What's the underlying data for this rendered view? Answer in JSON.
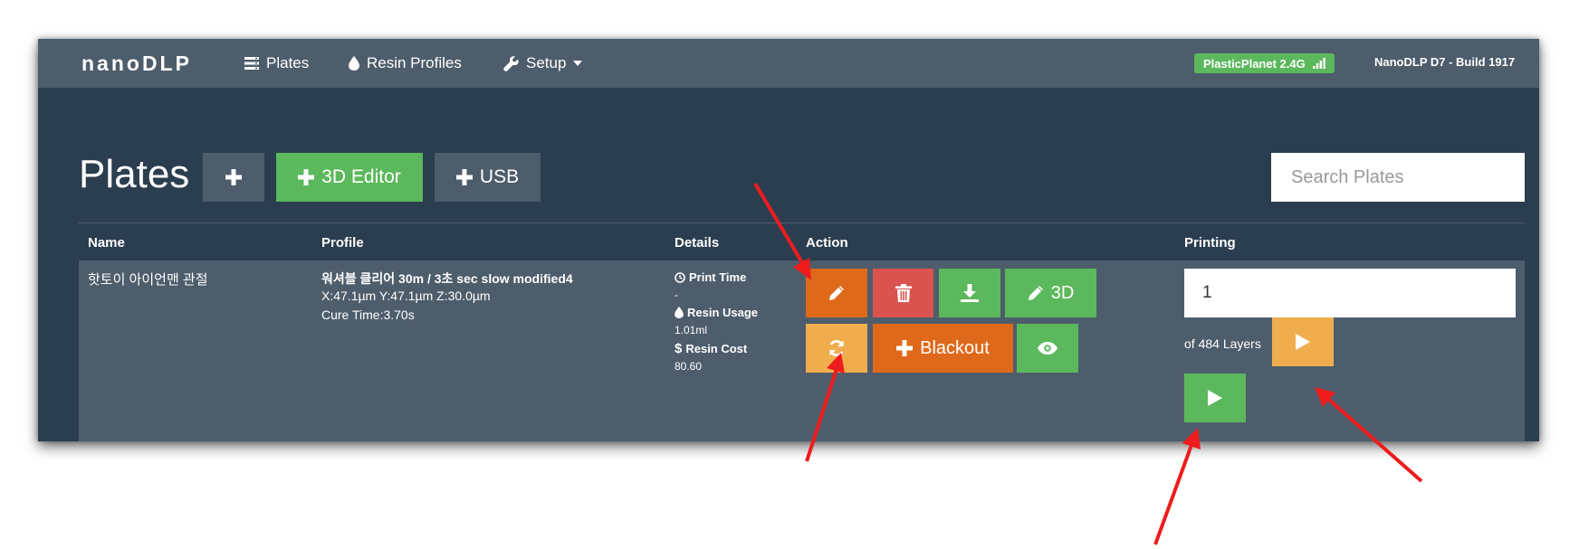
{
  "navbar": {
    "brand": "nanoDLP",
    "items": [
      {
        "label": "Plates",
        "icon": "list-icon"
      },
      {
        "label": "Resin Profiles",
        "icon": "drop-icon"
      },
      {
        "label": "Setup",
        "icon": "wrench-icon"
      }
    ],
    "wifi_label": "PlasticPlanet 2.4G",
    "version": "NanoDLP D7 - Build 1917"
  },
  "header": {
    "title": "Plates",
    "add_label": "+",
    "editor_label": "3D Editor",
    "usb_label": "USB",
    "search_placeholder": "Search Plates"
  },
  "table": {
    "columns": [
      "Name",
      "Profile",
      "Details",
      "Action",
      "Printing"
    ],
    "row": {
      "name": "핫토이 아이언맨 관절",
      "profile_line1": "워셔블 클리어 30m / 3초 sec slow modified4",
      "profile_line2": "X:47.1µm Y:47.1µm Z:30.0µm",
      "profile_line3": "Cure Time:3.70s",
      "print_time_label": "Print Time",
      "print_time_value": "-",
      "resin_usage_label": "Resin Usage",
      "resin_usage_value": "1.01ml",
      "resin_cost_label": "Resin Cost",
      "resin_cost_value": "80.60",
      "actions": {
        "threed_label": "3D",
        "blackout_label": "Blackout"
      },
      "printing": {
        "layer_value": "1",
        "layers_text": "of 484 Layers"
      }
    }
  },
  "colors": {
    "navbar": "#4e5d6c",
    "background": "#2b3e50",
    "green": "#5cb85c",
    "red": "#d9534f",
    "orange": "#df691a",
    "yellow": "#f0ad4e",
    "annotation_arrow": "#ee1c1c"
  }
}
